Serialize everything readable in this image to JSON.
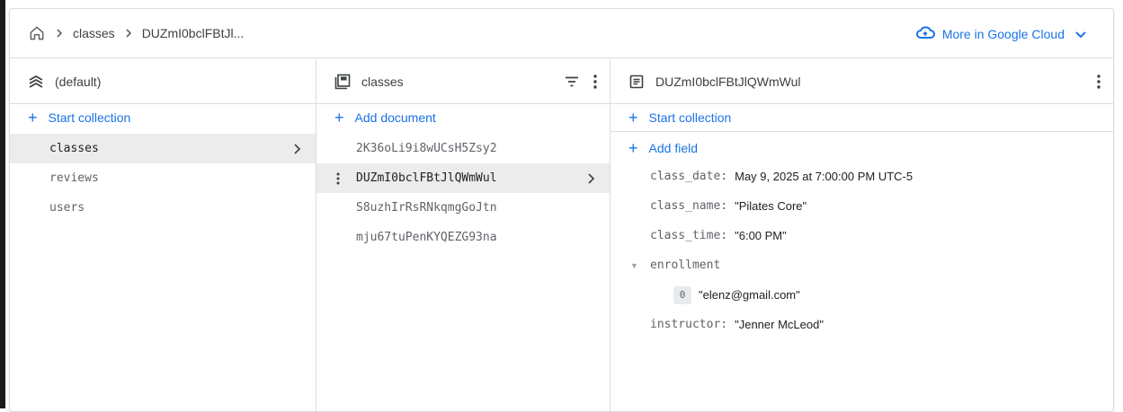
{
  "breadcrumb": {
    "home_icon": "home-icon",
    "items": [
      "classes",
      "DUZmI0bclFBtJl..."
    ]
  },
  "cloud": {
    "label": "More in Google Cloud",
    "icon": "cloud-icon",
    "color": "#1a73e8"
  },
  "col1": {
    "title": "(default)",
    "icon": "database-layers-icon",
    "add_label": "Start collection",
    "items": [
      {
        "label": "classes",
        "selected": true
      },
      {
        "label": "reviews"
      },
      {
        "label": "users"
      }
    ]
  },
  "col2": {
    "title": "classes",
    "icon": "collection-icon",
    "add_label": "Add document",
    "items": [
      {
        "label": "2K36oLi9i8wUCsH5Zsy2"
      },
      {
        "label": "DUZmI0bclFBtJlQWmWul",
        "selected": true
      },
      {
        "label": "S8uzhIrRsRNkqmgGoJtn"
      },
      {
        "label": "mju67tuPenKYQEZG93na"
      }
    ]
  },
  "col3": {
    "title": "DUZmI0bclFBtJlQWmWul",
    "icon": "document-icon",
    "start_collection_label": "Start collection",
    "add_field_label": "Add field",
    "fields": [
      {
        "key": "class_date",
        "value": "May 9, 2025 at 7:00:00 PM UTC-5"
      },
      {
        "key": "class_name",
        "value": "\"Pilates Core\""
      },
      {
        "key": "class_time",
        "value": "\"6:00 PM\""
      }
    ],
    "array_field": {
      "key": "enrollment",
      "items": [
        {
          "index": "0",
          "value": "\"elenz@gmail.com\""
        }
      ]
    },
    "last_field": {
      "key": "instructor",
      "value": "\"Jenner McLeod\""
    }
  }
}
